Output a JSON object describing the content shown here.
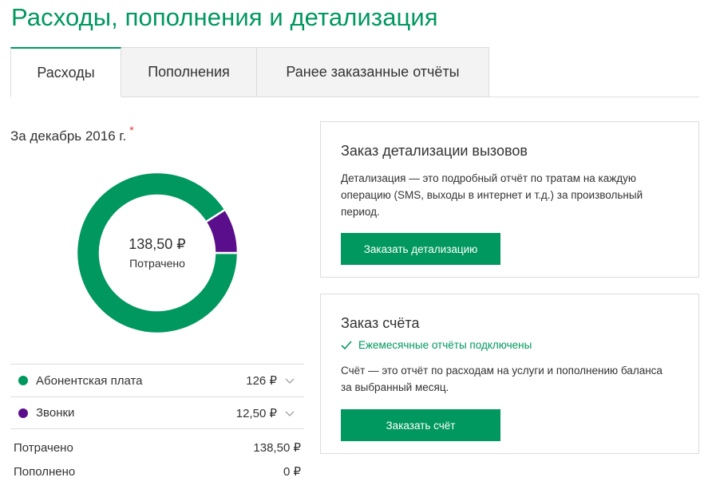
{
  "page": {
    "title": "Расходы, пополнения и детализация"
  },
  "tabs": [
    {
      "label": "Расходы",
      "active": true
    },
    {
      "label": "Пополнения",
      "active": false
    },
    {
      "label": "Ранее заказанные отчёты",
      "active": false
    }
  ],
  "period": {
    "label": "За декабрь 2016 г.",
    "required_mark": "*"
  },
  "summary": {
    "amount": "138,50 ₽",
    "label": "Потрачено"
  },
  "chart_data": {
    "type": "pie",
    "categories": [
      "Абонентская плата",
      "Звонки"
    ],
    "values": [
      126,
      12.5
    ],
    "colors": [
      "#00985f",
      "#5a0e8c"
    ]
  },
  "breakdown": [
    {
      "label": "Абонентская плата",
      "value": "126 ₽",
      "color": "#00985f"
    },
    {
      "label": "Звонки",
      "value": "12,50 ₽",
      "color": "#5a0e8c"
    }
  ],
  "totals": [
    {
      "label": "Потрачено",
      "value": "138,50 ₽"
    },
    {
      "label": "Пополнено",
      "value": "0 ₽"
    }
  ],
  "details_card": {
    "title": "Заказ детализации вызовов",
    "text": "Детализация — это подробный отчёт по тратам на каждую операцию (SMS, выходы в интернет и т.д.) за произвольный период.",
    "button": "Заказать детализацию"
  },
  "invoice_card": {
    "title": "Заказ счёта",
    "status": "Ежемесячные отчёты подключены",
    "text": "Счёт — это отчёт по расходам на услуги и пополнению баланса за выбранный месяц.",
    "button": "Заказать счёт"
  },
  "colors": {
    "accent": "#00985f",
    "calls": "#5a0e8c"
  }
}
